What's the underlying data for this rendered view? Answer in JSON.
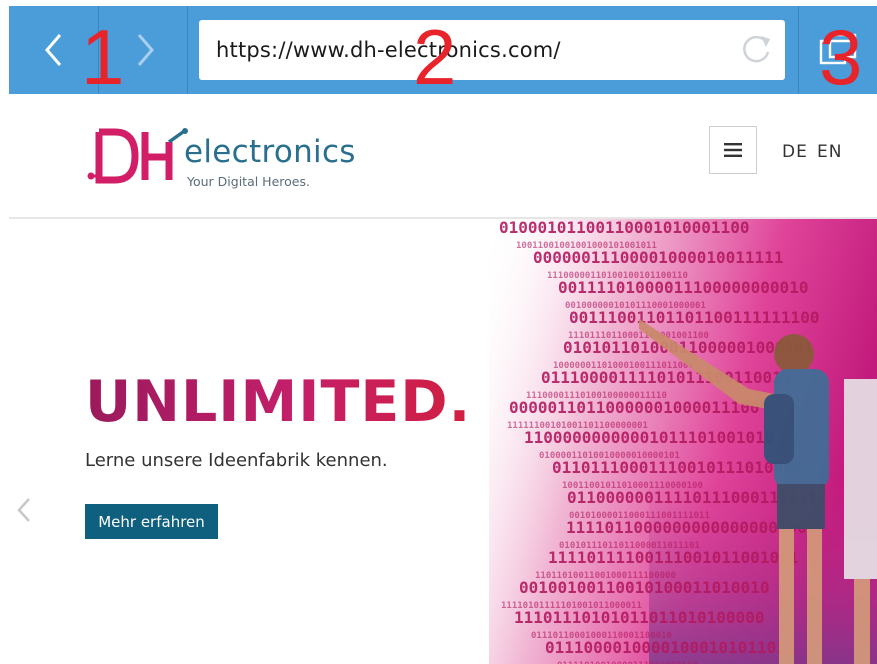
{
  "browser": {
    "url": "https://www.dh-electronics.com/",
    "markers": [
      "1",
      "2",
      "3"
    ],
    "icons": {
      "back": "chevron-left-icon",
      "forward": "chevron-right-icon",
      "reload": "reload-icon",
      "tabs": "tabs-icon"
    },
    "colors": {
      "toolbar": "#4a9dd9",
      "marker": "#e8232a"
    }
  },
  "site": {
    "logo_mark": "DH",
    "logo_word": "electronics",
    "logo_tagline": "Your Digital Heroes.",
    "menu_icon": "hamburger-menu-icon",
    "languages": [
      "DE",
      "EN"
    ],
    "colors": {
      "brand_magenta": "#c41f6a",
      "brand_teal": "#2a6f8e",
      "cta": "#0f5f7e"
    }
  },
  "hero": {
    "title": "UNLIMITED.",
    "subtitle": "Lerne unsere Ideenfabrik kennen.",
    "cta_label": "Mehr erfahren",
    "prev_icon": "chevron-left-icon"
  }
}
